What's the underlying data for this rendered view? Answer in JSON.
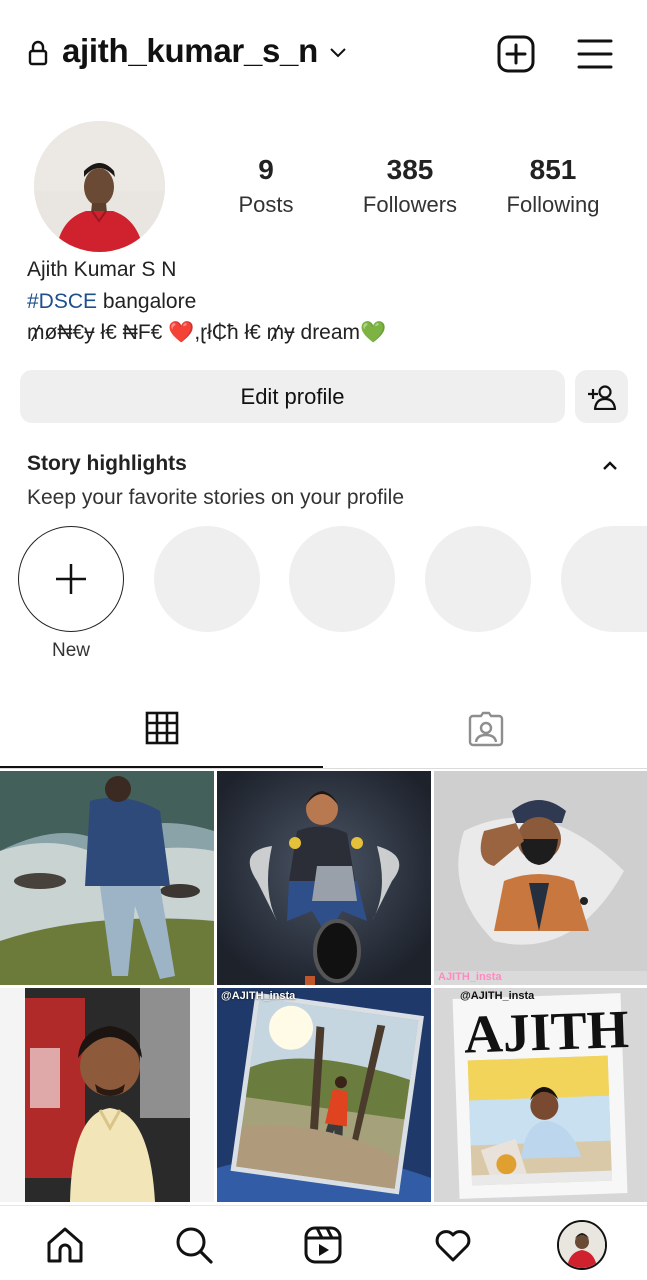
{
  "header": {
    "username": "ajith_kumar_s_n",
    "icons": [
      "lock-icon",
      "chevron-down-icon",
      "new-post-icon",
      "menu-icon"
    ]
  },
  "profile": {
    "stats": [
      {
        "value": "9",
        "label": "Posts"
      },
      {
        "value": "385",
        "label": "Followers"
      },
      {
        "value": "851",
        "label": "Following"
      }
    ],
    "full_name": "Ajith Kumar S N",
    "bio_hashtag": "#DSCE",
    "bio_line1_rest": " bangalore",
    "bio_line2": "₥ø₦€ɏ ł€ ₦F€ ❤️,ɽł₵ħ ł€ ₥ɏ dream💚",
    "edit_profile_label": "Edit profile"
  },
  "story_highlights": {
    "title": "Story highlights",
    "subtitle": "Keep your favorite stories on your profile",
    "new_label": "New"
  },
  "grid": {
    "watermarks": [
      "AJITH_insta",
      "@AJITH_insta",
      "@AJITH_insta"
    ]
  },
  "colors": {
    "hashtag": "#1f4f8c",
    "button_bg": "#efefef",
    "heart_red": "#e0245e",
    "heart_green": "#6cc04a"
  }
}
